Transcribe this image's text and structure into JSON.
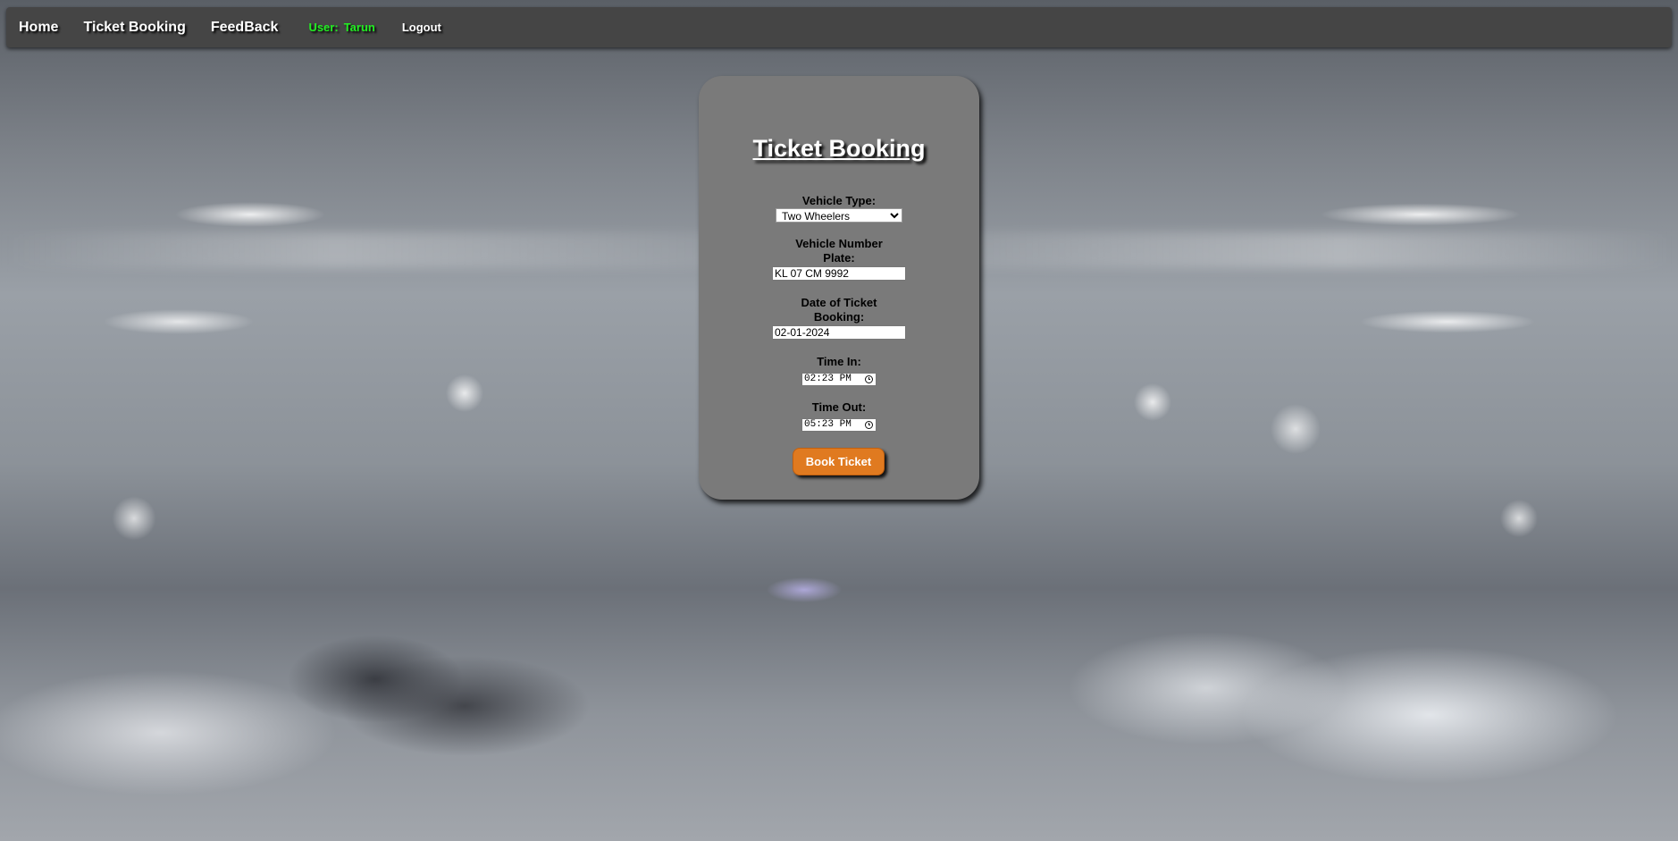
{
  "nav": {
    "home": "Home",
    "ticket_booking": "Ticket Booking",
    "feedback": "FeedBack",
    "user_label": "User:",
    "user_name": "Tarun",
    "logout": "Logout"
  },
  "form": {
    "title": "Ticket Booking",
    "vehicle_type": {
      "label": "Vehicle Type:",
      "value": "Two Wheelers"
    },
    "number_plate": {
      "label": "Vehicle Number Plate:",
      "value": "KL 07 CM 9992"
    },
    "booking_date": {
      "label": "Date of Ticket Booking:",
      "value": "02-01-2024"
    },
    "time_in": {
      "label": "Time In:",
      "value": "02:23 PM"
    },
    "time_out": {
      "label": "Time Out:",
      "value": "05:23 PM"
    },
    "submit_label": "Book Ticket"
  },
  "icons": {
    "time_picker": "clock-icon",
    "select_arrow": "chevron-down-icon"
  },
  "colors": {
    "nav_bg": "#454545",
    "card_bg": "#7a7a7a",
    "button_bg": "#e07a20",
    "user_text": "#22ee22"
  }
}
